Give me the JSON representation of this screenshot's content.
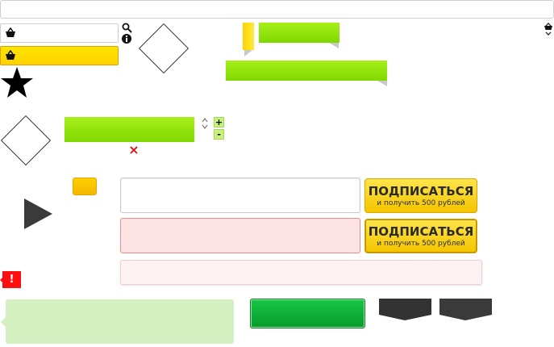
{
  "search": {
    "placeholder": ""
  },
  "subscribe": {
    "label": "ПОДПИСАТЬСЯ",
    "sublabel": "и получить 500 рублей"
  },
  "alert": {
    "symbol": "!"
  },
  "stepper": {
    "plus": "+",
    "minus": "-"
  },
  "error_icon": {
    "symbol": "×"
  },
  "colors": {
    "yellow": "#ffd400",
    "green": "#8de00a",
    "error_red": "#ff1010",
    "dark": "#333333",
    "success_green": "#0fb43a"
  },
  "icons": [
    "cart-icon",
    "search-icon",
    "info-icon",
    "star-icon",
    "play-icon",
    "close-icon",
    "sort-icon",
    "alert-icon"
  ]
}
